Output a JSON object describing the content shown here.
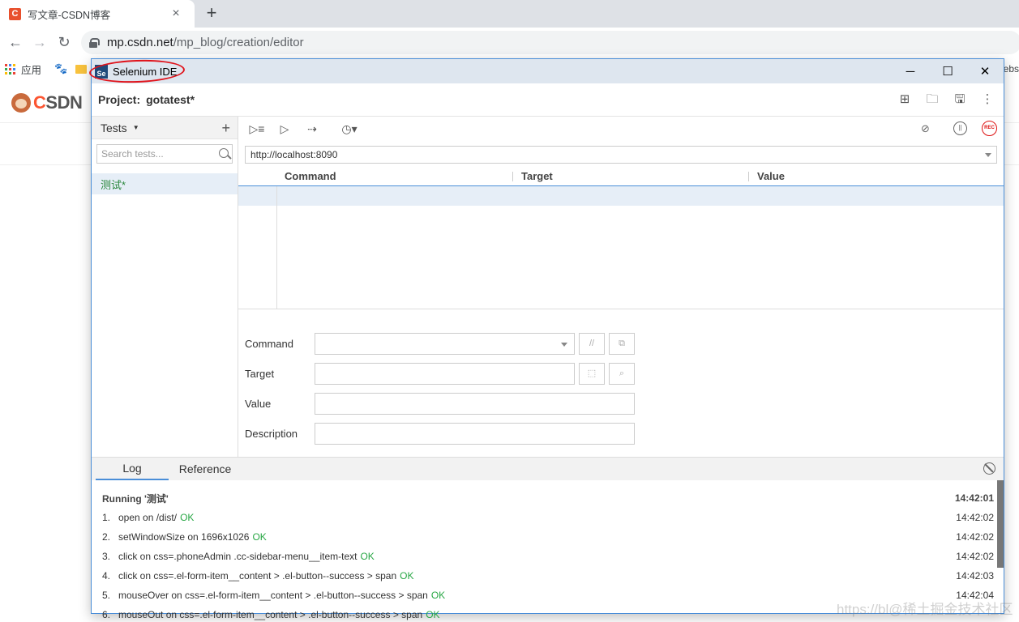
{
  "browser": {
    "tab": {
      "title": "写文章-CSDN博客",
      "favicon_letter": "C",
      "close_icon": "×"
    },
    "new_tab_icon": "+",
    "url_host": "mp.csdn.net",
    "url_path": "/mp_blog/creation/editor",
    "bookmarks": {
      "apps_label": "应用",
      "right_fragment": "ebs"
    }
  },
  "csdn": {
    "logo_prefix": "C",
    "logo_rest": "SDN"
  },
  "ide": {
    "window_title": "Selenium IDE",
    "logo_text": "Se",
    "project_label": "Project:",
    "project_name": "gotatest*",
    "tests_header": "Tests",
    "search_placeholder": "Search tests...",
    "tests": [
      {
        "name": "测试*"
      }
    ],
    "base_url": "http://localhost:8090",
    "columns": {
      "command": "Command",
      "target": "Target",
      "value": "Value"
    },
    "rec_label": "REC",
    "form": {
      "command_label": "Command",
      "target_label": "Target",
      "value_label": "Value",
      "description_label": "Description",
      "comment_btn": "//"
    },
    "log_tabs": {
      "log": "Log",
      "reference": "Reference"
    },
    "log": {
      "running": "Running '测试'",
      "running_time": "14:42:01",
      "entries": [
        {
          "num": "1.",
          "text": "open on /dist/",
          "status": "OK",
          "time": "14:42:02"
        },
        {
          "num": "2.",
          "text": "setWindowSize on 1696x1026",
          "status": "OK",
          "time": "14:42:02"
        },
        {
          "num": "3.",
          "text": "click on css=.phoneAdmin .cc-sidebar-menu__item-text",
          "status": "OK",
          "time": "14:42:02"
        },
        {
          "num": "4.",
          "text": "click on css=.el-form-item__content > .el-button--success > span",
          "status": "OK",
          "time": "14:42:03"
        },
        {
          "num": "5.",
          "text": "mouseOver on css=.el-form-item__content > .el-button--success > span",
          "status": "OK",
          "time": "14:42:04"
        },
        {
          "num": "6.",
          "text": "mouseOut on css=.el-form-item__content > .el-button--success > span",
          "status": "OK",
          "time": ""
        }
      ]
    }
  },
  "watermark": "https://bl@稀土掘金技术社区",
  "colors": {
    "accent": "#4a8ed8",
    "ok": "#28a745",
    "rec": "#dd1111",
    "annotation": "#e0141c"
  }
}
